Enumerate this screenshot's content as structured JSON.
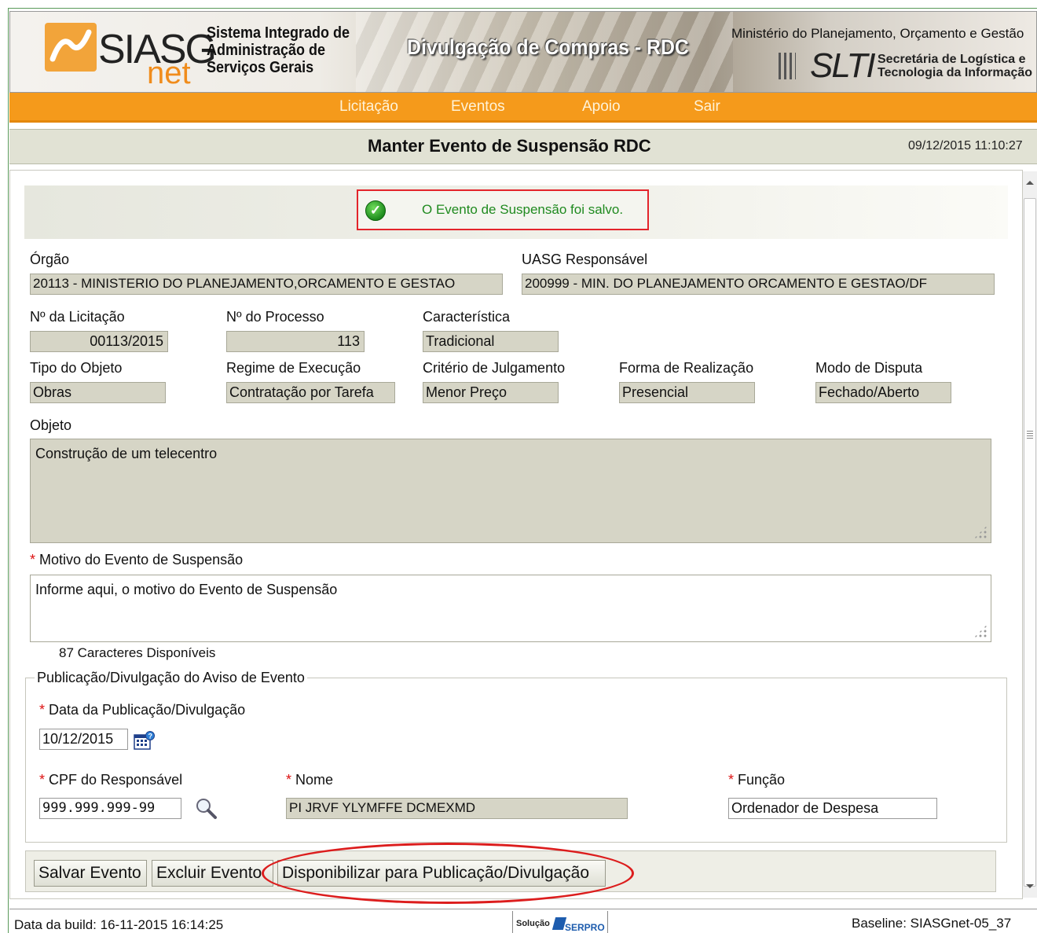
{
  "header": {
    "logo_text": "SIASG",
    "logo_sub": "net",
    "system_name_line1": "Sistema Integrado de",
    "system_name_line2": "Administração de",
    "system_name_line3": "Serviços Gerais",
    "app_title": "Divulgação de Compras - RDC",
    "ministry": "Ministério do Planejamento, Orçamento e Gestão",
    "slti": "SLTI",
    "slti_line1": "Secretária de Logística e",
    "slti_line2": "Tecnologia da Informação"
  },
  "menu": {
    "items": [
      {
        "label": "Licitação"
      },
      {
        "label": "Eventos"
      },
      {
        "label": "Apoio"
      },
      {
        "label": "Sair"
      }
    ]
  },
  "page": {
    "title": "Manter Evento de Suspensão RDC",
    "datetime": "09/12/2015 11:10:27"
  },
  "message": {
    "text": "O Evento de Suspensão foi salvo."
  },
  "form": {
    "orgao_label": "Órgão",
    "orgao_value": "20113 - MINISTERIO DO PLANEJAMENTO,ORCAMENTO E GESTAO",
    "uasg_label": "UASG Responsável",
    "uasg_value": "200999 - MIN. DO PLANEJAMENTO ORCAMENTO E GESTAO/DF",
    "licitacao_label": "Nº da Licitação",
    "licitacao_value": "00113/2015",
    "processo_label": "Nº do Processo",
    "processo_value": "113",
    "caracteristica_label": "Característica",
    "caracteristica_value": "Tradicional",
    "tipo_objeto_label": "Tipo do Objeto",
    "tipo_objeto_value": "Obras",
    "regime_label": "Regime de Execução",
    "regime_value": "Contratação por Tarefa",
    "criterio_label": "Critério de Julgamento",
    "criterio_value": "Menor Preço",
    "forma_label": "Forma de Realização",
    "forma_value": "Presencial",
    "modo_label": "Modo de Disputa",
    "modo_value": "Fechado/Aberto",
    "objeto_label": "Objeto",
    "objeto_value": "Construção de um telecentro",
    "motivo_label": "Motivo do Evento de Suspensão",
    "motivo_value": "Informe aqui, o motivo do Evento de Suspensão",
    "caracteres": "87 Caracteres Disponíveis"
  },
  "publicacao": {
    "legend": "Publicação/Divulgação do Aviso de Evento",
    "data_label": "Data da Publicação/Divulgação",
    "data_value": "10/12/2015",
    "cpf_label": "CPF do Responsável",
    "cpf_value": "999.999.999-99",
    "nome_label": "Nome",
    "nome_value": "PI JRVF YLYMFFE DCMEXMD",
    "funcao_label": "Função",
    "funcao_value": "Ordenador de Despesa"
  },
  "buttons": {
    "salvar": "Salvar Evento",
    "excluir": "Excluir Evento",
    "disponibilizar": "Disponibilizar para Publicação/Divulgação"
  },
  "footer": {
    "build": "Data da build: 16-11-2015 16:14:25",
    "solucao": "Solução",
    "serpro": "SERPRO",
    "baseline": "Baseline: SIASGnet-05_37"
  }
}
